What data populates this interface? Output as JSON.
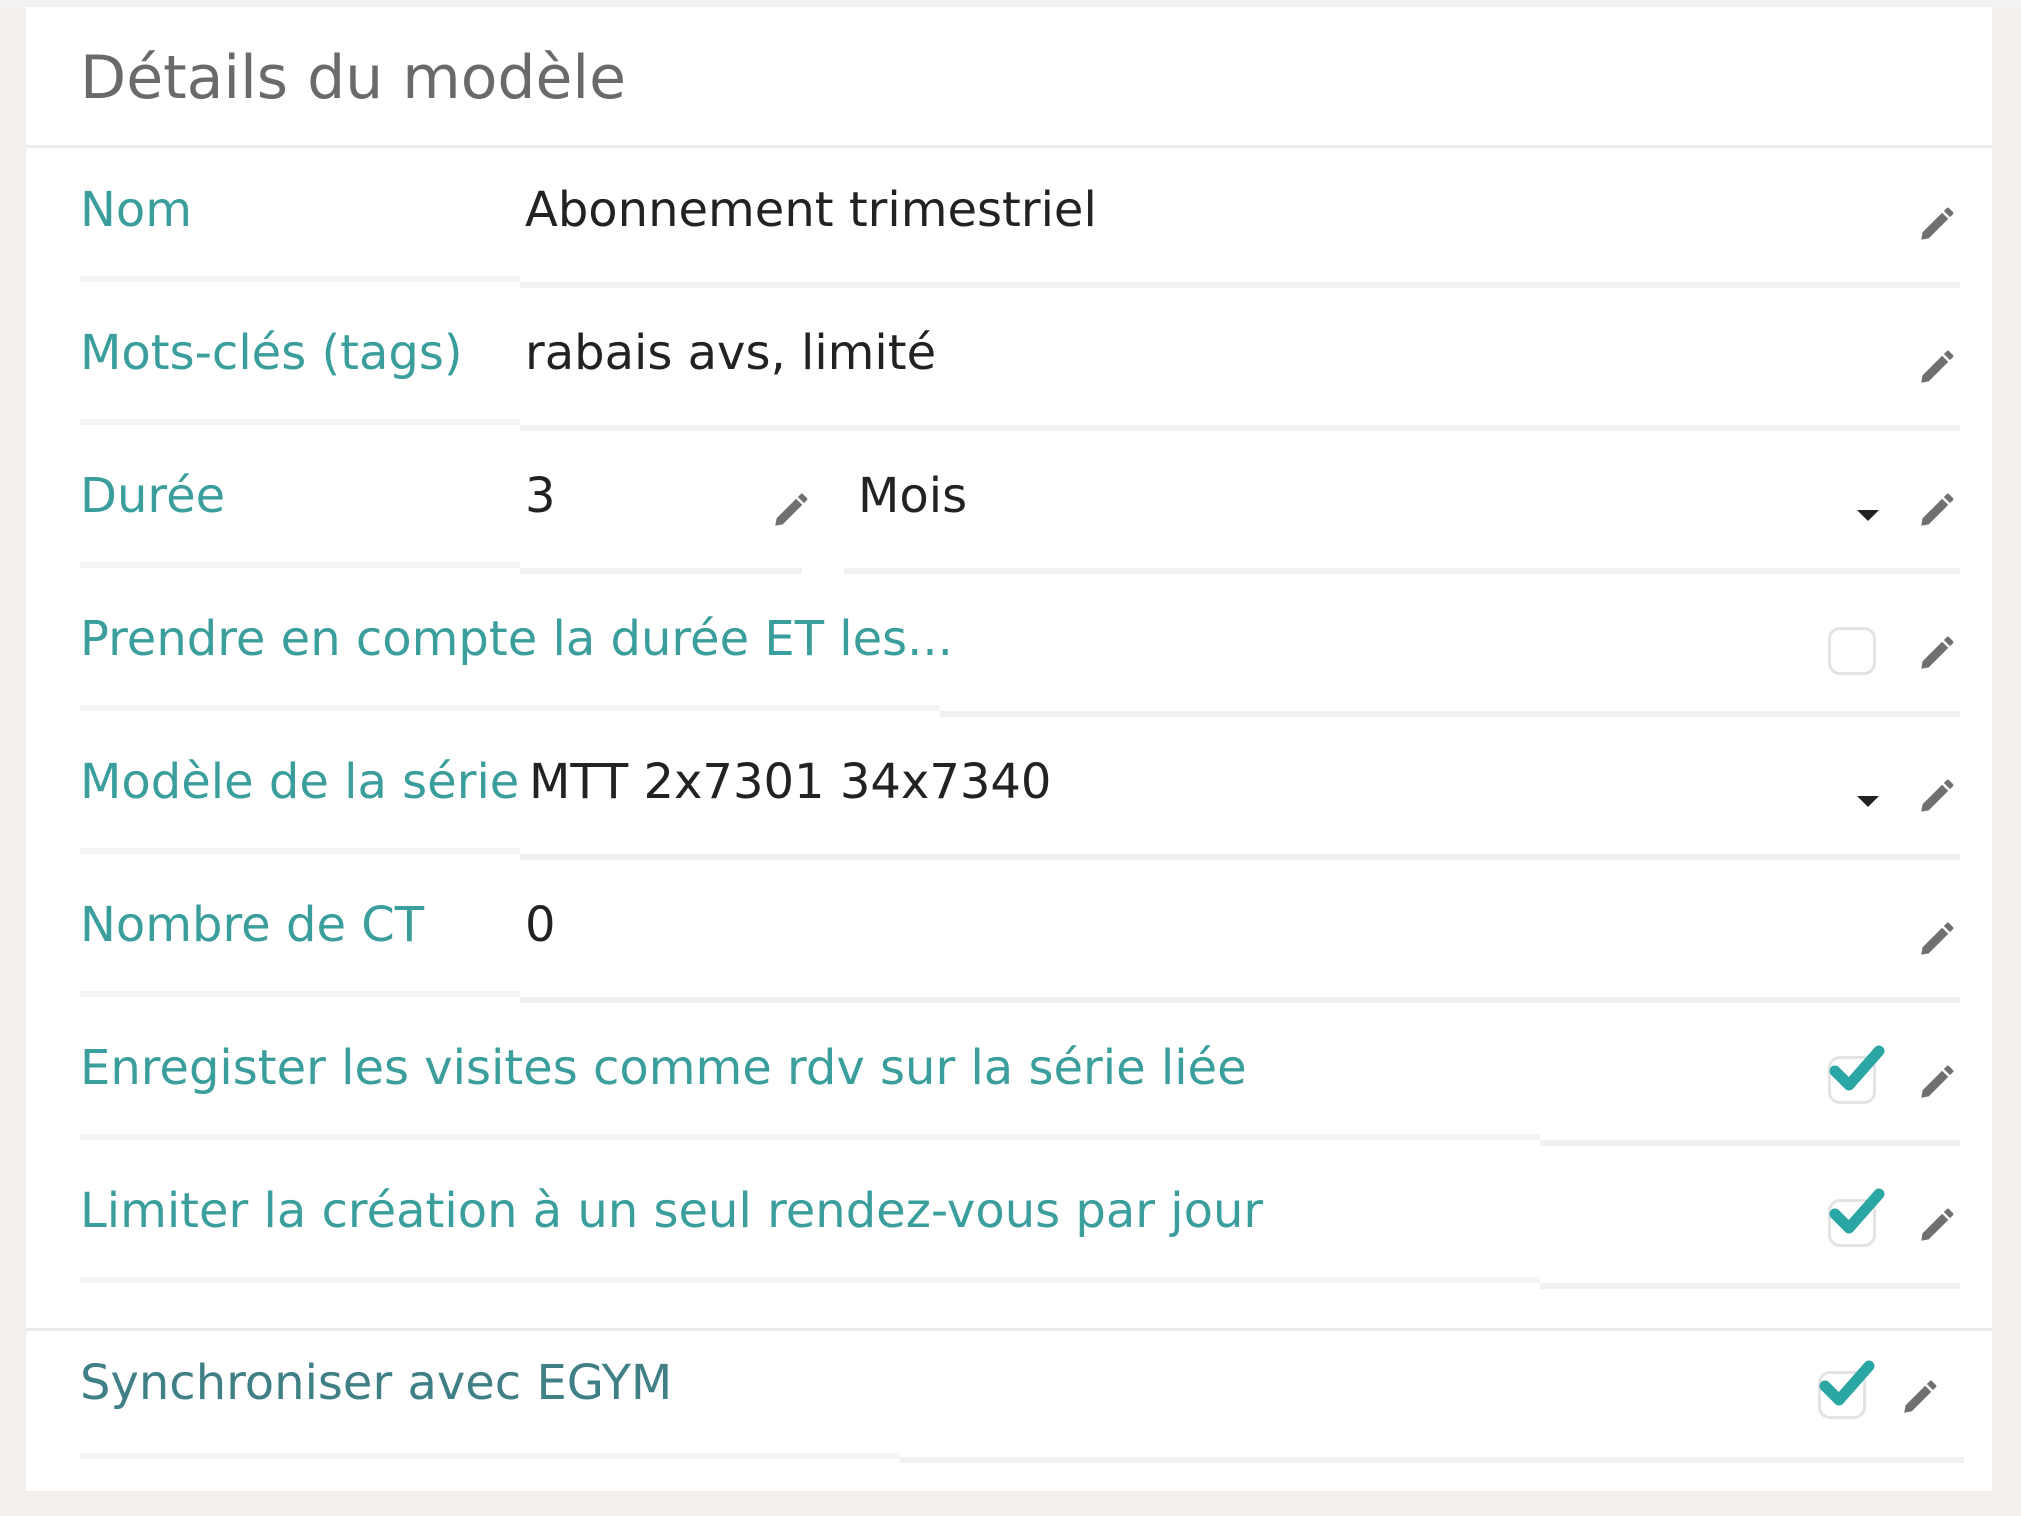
{
  "header": {
    "title": "Détails du modèle"
  },
  "fields": {
    "nom": {
      "label": "Nom",
      "value": "Abonnement trimestriel"
    },
    "tags": {
      "label": "Mots-clés (tags)",
      "value": "rabais avs, limité"
    },
    "duree": {
      "label": "Durée",
      "value": "3",
      "unit": "Mois"
    },
    "prendre": {
      "label": "Prendre en compte la durée ET les...",
      "checked": false
    },
    "serie": {
      "label": "Modèle de la série",
      "value": "MTT 2x7301 34x7340"
    },
    "ct": {
      "label": "Nombre de CT",
      "value": "0"
    },
    "visites": {
      "label": "Enregister les visites comme rdv sur la série liée",
      "checked": true
    },
    "limiter": {
      "label": "Limiter la création à un seul rendez-vous par jour",
      "checked": true
    },
    "egym": {
      "label": "Synchroniser avec EGYM",
      "checked": true
    }
  },
  "colors": {
    "accent": "#3a9e9c",
    "check": "#2aa7a5",
    "text": "#222222",
    "title": "#6a6a6a"
  },
  "icons": {
    "edit": "pencil-icon",
    "dropdown": "caret-down-icon",
    "checkbox": "checkbox-icon"
  }
}
